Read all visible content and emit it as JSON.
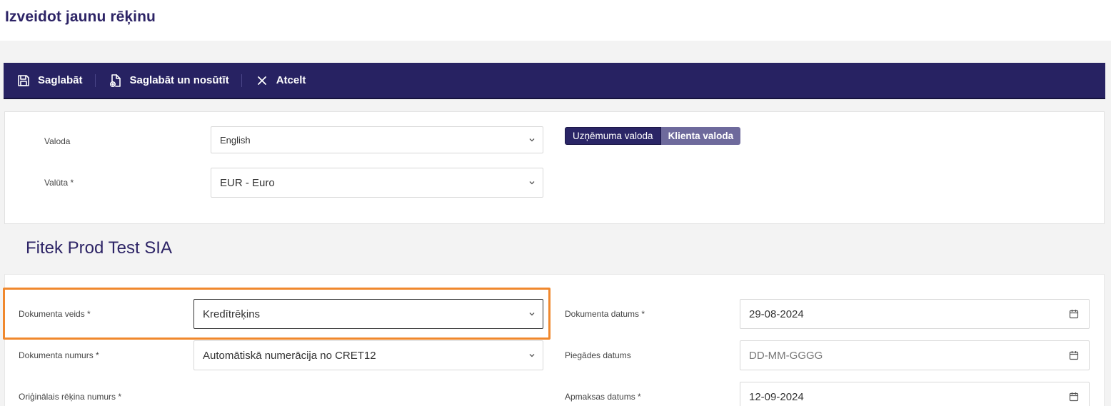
{
  "page": {
    "title": "Izveidot jaunu rēķinu"
  },
  "toolbar": {
    "save_label": "Saglabāt",
    "save_send_label": "Saglabāt un nosūtīt",
    "cancel_label": "Atcelt"
  },
  "settings": {
    "language": {
      "label": "Valoda",
      "value": "English"
    },
    "currency": {
      "label": "Valūta *",
      "value": "EUR - Euro"
    },
    "language_toggle": {
      "company_label": "Uzņēmuma valoda",
      "client_label": "Klienta valoda",
      "selected": "Uzņēmuma valoda"
    }
  },
  "company": {
    "name": "Fitek Prod Test SIA"
  },
  "document": {
    "type": {
      "label": "Dokumenta veids *",
      "value": "Kredītrēķins"
    },
    "number": {
      "label": "Dokumenta numurs *",
      "value": "Automātiskā numerācija no CRET12"
    },
    "original_number": {
      "label": "Oriģinālais rēķina numurs *"
    },
    "date": {
      "label": "Dokumenta datums *",
      "value": "29-08-2024"
    },
    "delivery_date": {
      "label": "Piegādes datums",
      "placeholder": "DD-MM-GGGG"
    },
    "due_date": {
      "label": "Apmaksas datums *",
      "value": "12-09-2024"
    }
  },
  "colors": {
    "primary": "#272262",
    "accent_highlight": "#f0882d",
    "secondary_button": "#6e6a9c"
  }
}
